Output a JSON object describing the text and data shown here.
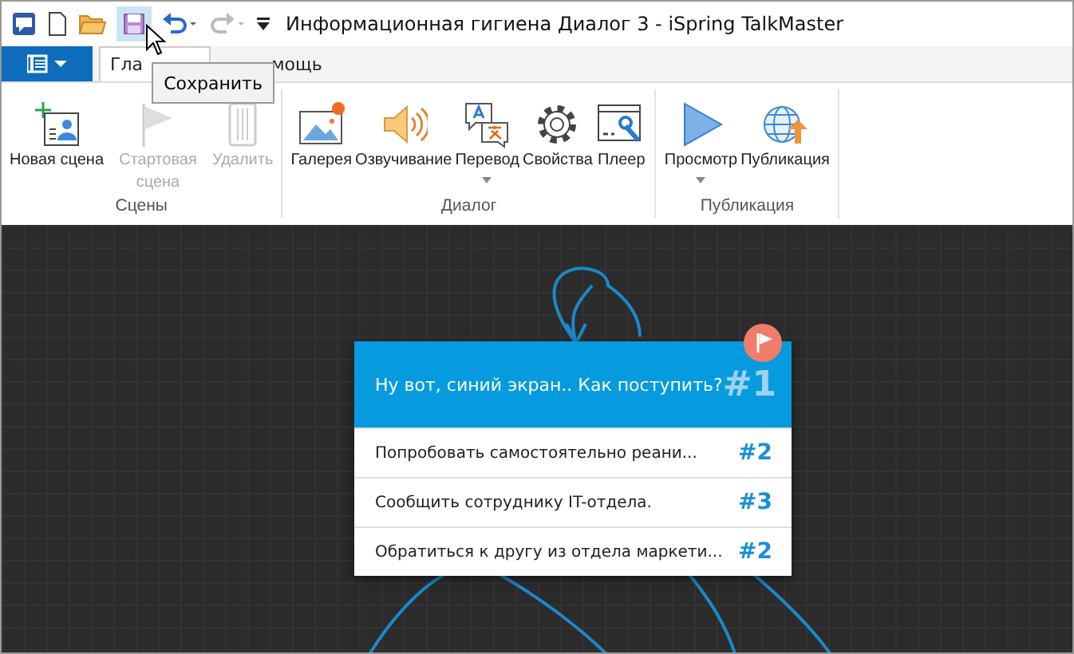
{
  "window": {
    "title": "Информационная гигиена Диалог 3 - iSpring TalkMaster"
  },
  "tabs": [
    {
      "label": "Гла",
      "selected": true
    },
    {
      "label": "мощь",
      "selected": false
    }
  ],
  "tooltip": "Сохранить",
  "ribbon": {
    "groups": [
      {
        "label": "Сцены",
        "items": [
          {
            "label": "Новая сцена",
            "disabled": false,
            "dropdown": false
          },
          {
            "label": "Стартовая сцена",
            "disabled": true,
            "dropdown": false
          },
          {
            "label": "Удалить",
            "disabled": true,
            "dropdown": false
          }
        ]
      },
      {
        "label": "Диалог",
        "items": [
          {
            "label": "Галерея",
            "disabled": false,
            "dropdown": false
          },
          {
            "label": "Озвучивание",
            "disabled": false,
            "dropdown": false
          },
          {
            "label": "Перевод",
            "disabled": false,
            "dropdown": true
          },
          {
            "label": "Свойства",
            "disabled": false,
            "dropdown": false
          },
          {
            "label": "Плеер",
            "disabled": false,
            "dropdown": false
          }
        ]
      },
      {
        "label": "Публикация",
        "items": [
          {
            "label": "Просмотр",
            "disabled": false,
            "dropdown": true
          },
          {
            "label": "Публикация",
            "disabled": false,
            "dropdown": false
          }
        ]
      }
    ]
  },
  "scene": {
    "question": "Ну вот, синий экран.. Как поступить?",
    "number": "#1",
    "start": true,
    "answers": [
      {
        "text": "Попробовать самостоятельно реани...",
        "target": "#2"
      },
      {
        "text": "Сообщить сотруднику IT-отдела.",
        "target": "#3"
      },
      {
        "text": "Обратиться к другу из отдела маркети...",
        "target": "#2"
      }
    ]
  }
}
